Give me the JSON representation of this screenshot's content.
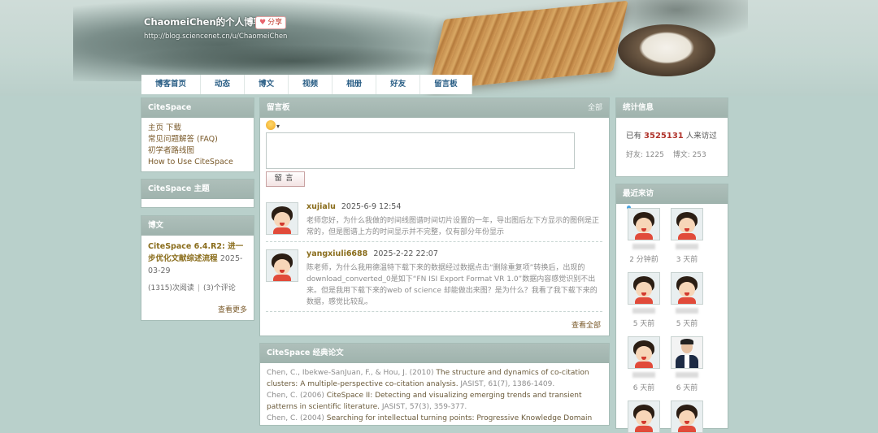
{
  "header": {
    "title": "ChaomeiChen的个人博客",
    "share_label": "分享",
    "url": "http://blog.sciencenet.cn/u/ChaomeiChen"
  },
  "nav": {
    "items": [
      "博客首页",
      "动态",
      "博文",
      "视频",
      "相册",
      "好友",
      "留言板"
    ]
  },
  "left": {
    "citespace_title": "CiteSpace",
    "citespace_links": [
      "主页 下载",
      "常见问题解答 (FAQ)",
      "初学者路线图",
      "How to Use CiteSpace"
    ],
    "theme_title": "CiteSpace 主题",
    "posts_title": "博文",
    "post": {
      "title": "CiteSpace 6.4.R2: 进一步优化文献综述流程",
      "date": "2025-03-29",
      "reads": "(1315)次阅读",
      "comments": "(3)个评论"
    },
    "see_more": "查看更多"
  },
  "guestbook": {
    "title": "留言板",
    "all_label": "全部",
    "smiley_caret": "▾",
    "input_value": "",
    "submit_label": "留言",
    "comments": [
      {
        "user": "xujialu",
        "time": "2025-6-9 12:54",
        "text": "老师您好，为什么我做的时间线图谱时间切片设置的一年，导出图后左下方显示的图例是正常的，但是图谱上方的时间显示并不完整，仅有部分年份显示"
      },
      {
        "user": "yangxiuli6688",
        "time": "2025-2-22 22:07",
        "text": "陈老师，为什么我用德温特下载下来的数据经过数据点击“删除重复项”转换后，出现的download_converted_0是如下“FN ISI Export Format VR 1.0”数据内容感觉识别不出来。但是我用下载下来的web of science 却能做出来图？是为什么？我看了我下载下来的数据，感觉比较乱。"
      }
    ],
    "view_all": "查看全部"
  },
  "papers": {
    "title": "CiteSpace 经典论文",
    "items": [
      {
        "authors": "Chen, C., Ibekwe-SanJuan, F., & Hou, J. (2010) ",
        "title": "The structure and dynamics of co-citation clusters: A multiple-perspective co-citation analysis.",
        "source": " JASIST, 61(7), 1386-1409."
      },
      {
        "authors": "Chen, C. (2006) ",
        "title": "CiteSpace II: Detecting and visualizing emerging trends and transient patterns in scientific literature.",
        "source": " JASIST, 57(3), 359-377."
      },
      {
        "authors": "Chen, C. (2004) ",
        "title": "Searching for intellectual turning points: Progressive Knowledge Domain",
        "source": ""
      }
    ]
  },
  "stats": {
    "title": "统计信息",
    "visits_prefix": "已有 ",
    "visits_count": "3525131",
    "visits_suffix": " 人来访过",
    "friends": "好友: 1225",
    "posts": "博文: 253"
  },
  "recent": {
    "title": "最近来访",
    "visitors": [
      {
        "time": "2 分钟前"
      },
      {
        "time": "3 天前"
      },
      {
        "time": "5 天前"
      },
      {
        "time": "5 天前"
      },
      {
        "time": "6 天前"
      },
      {
        "time": "6 天前"
      }
    ]
  }
}
